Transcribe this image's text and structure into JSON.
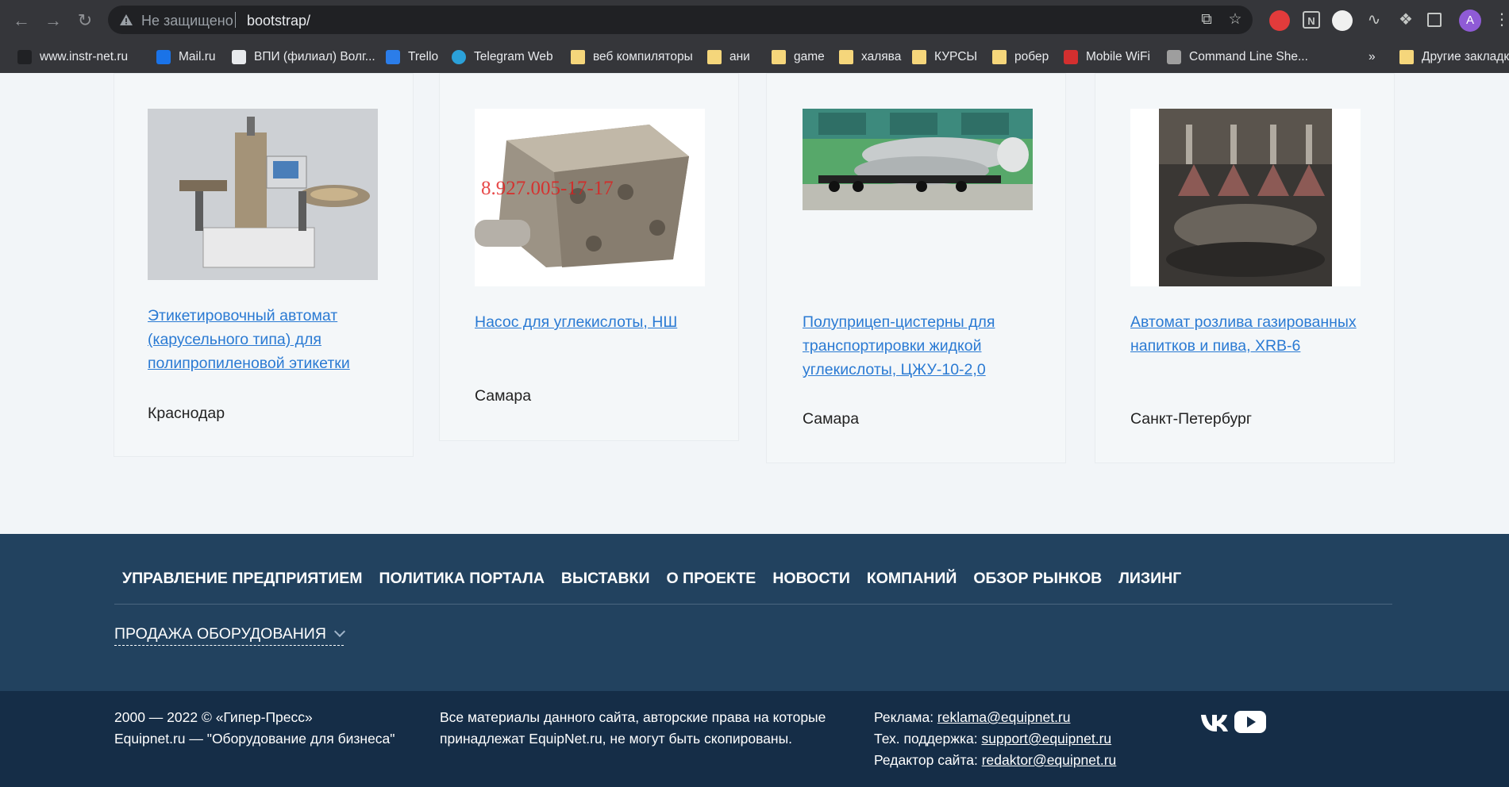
{
  "browser": {
    "tab_colors": [
      "#e9483f",
      "#f1c033",
      "#3fa764"
    ],
    "address_status": "Не защищено",
    "address_url": "bootstrap/",
    "profile_initial": "A",
    "bookmarks": [
      {
        "label": "www.instr-net.ru",
        "icon": "site-icon"
      },
      {
        "label": "Mail.ru",
        "icon": "mail-icon"
      },
      {
        "label": "ВПИ (филиал) Волг...",
        "icon": "university-icon"
      },
      {
        "label": "Trello",
        "icon": "trello-icon"
      },
      {
        "label": "Telegram Web",
        "icon": "telegram-icon"
      },
      {
        "label": "веб компиляторы",
        "icon": "folder-icon"
      },
      {
        "label": "ани",
        "icon": "folder-icon"
      },
      {
        "label": "game",
        "icon": "folder-icon"
      },
      {
        "label": "халява",
        "icon": "folder-icon"
      },
      {
        "label": "КУРСЫ",
        "icon": "folder-icon"
      },
      {
        "label": "робер",
        "icon": "folder-icon"
      },
      {
        "label": "Mobile WiFi",
        "icon": "huawei-icon"
      },
      {
        "label": "Command Line She...",
        "icon": "book-icon"
      }
    ],
    "overflow_label": "»",
    "other_bookmarks": "Другие закладки"
  },
  "cards": [
    {
      "title": "Этикетировочный автомат (карусельного типа) для полипропиленовой этикетки",
      "city": "Краснодар",
      "image": "labeling-machine"
    },
    {
      "title": "Насос для углекислоты, НШ",
      "city": "Самара",
      "image": "pump",
      "image_caption": "8.927.005-17-17"
    },
    {
      "title": "Полуприцеп-цистерны для транспортировки жидкой углекислоты, ЦЖУ-10-2,0",
      "city": "Самара",
      "image": "tank-trailers"
    },
    {
      "title": "Автомат розлива газированных напитков и пива, XRB-6",
      "city": "Санкт-Петербург",
      "image": "bottling-machine"
    }
  ],
  "footer": {
    "nav": [
      "УПРАВЛЕНИЕ ПРЕДПРИЯТИЕМ",
      "ПОЛИТИКА ПОРТАЛА",
      "ВЫСТАВКИ",
      "О ПРОЕКТЕ",
      "НОВОСТИ",
      "КОМПАНИЙ",
      "ОБЗОР РЫНКОВ",
      "ЛИЗИНГ"
    ],
    "sale_dropdown": "ПРОДАЖА ОБОРУДОВАНИЯ",
    "copyright_line1": "2000 — 2022 © «Гипер-Пресс»",
    "copyright_line2": "Equipnet.ru — \"Оборудование для бизнеса\"",
    "rights_line1": "Все материалы данного сайта, авторские права на которые",
    "rights_line2": "принадлежат EquipNet.ru, не могут быть скопированы.",
    "contacts": [
      {
        "label": "Реклама: ",
        "email": "reklama@equipnet.ru"
      },
      {
        "label": "Тех. поддержка: ",
        "email": "support@equipnet.ru"
      },
      {
        "label": "Редактор сайта: ",
        "email": "redaktor@equipnet.ru"
      }
    ],
    "social": [
      "vk-icon",
      "youtube-icon"
    ]
  }
}
